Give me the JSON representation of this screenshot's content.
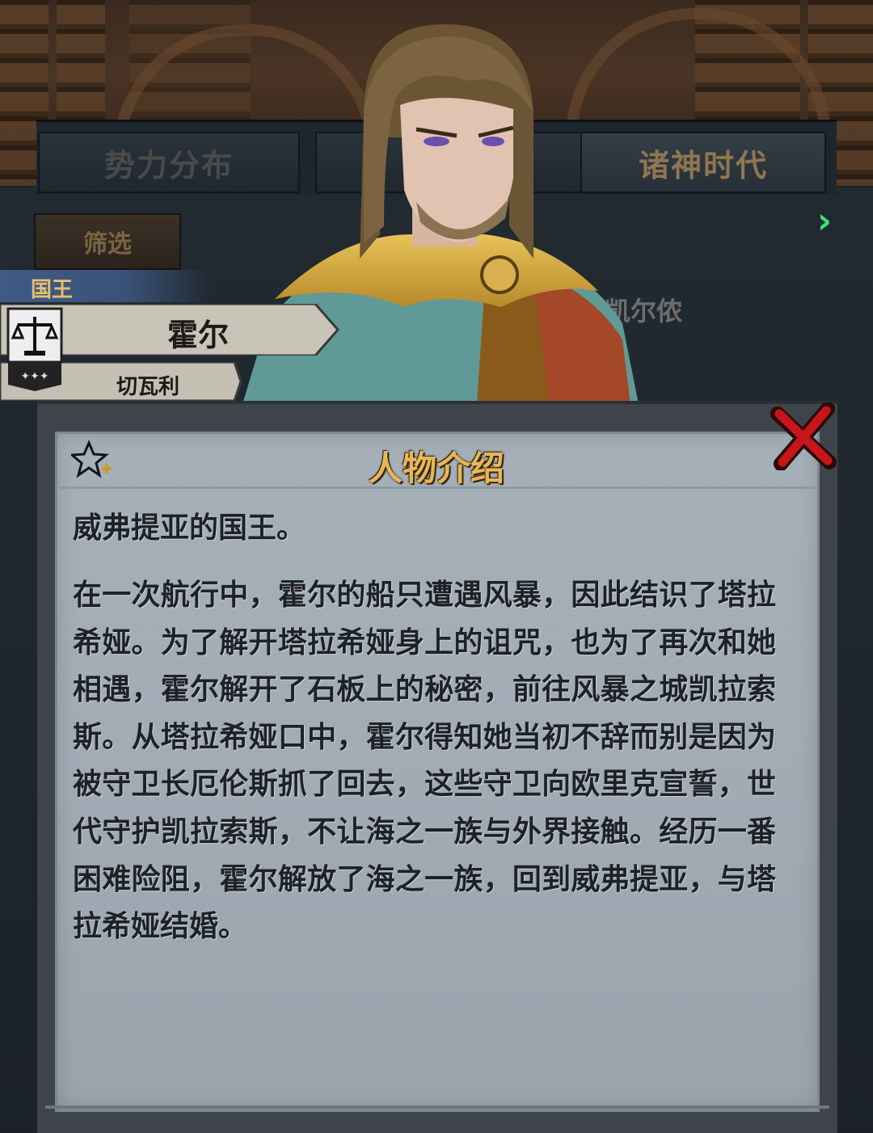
{
  "tabs": [
    {
      "label": "势力分布",
      "active": false
    },
    {
      "label": "",
      "active": false
    },
    {
      "label": "诸神时代",
      "active": true
    }
  ],
  "filter": {
    "label": "筛选"
  },
  "background_list": {
    "visible_name": "凯尔侬"
  },
  "character": {
    "title": "国王",
    "name": "霍尔",
    "faction": "切瓦利"
  },
  "intro": {
    "heading": "人物介绍",
    "lead": "威弗提亚的国王。",
    "body": "在一次航行中，霍尔的船只遭遇风暴，因此结识了塔拉希娅。为了解开塔拉希娅身上的诅咒，也为了再次和她相遇，霍尔解开了石板上的秘密，前往风暴之城凯拉索斯。从塔拉希娅口中，霍尔得知她当初不辞而别是因为被守卫长厄伦斯抓了回去，这些守卫向欧里克宣誓，世代守护凯拉索斯，不让海之一族与外界接触。经历一番困难险阻，霍尔解放了海之一族，回到威弗提亚，与塔拉希娅结婚。"
  },
  "icons": {
    "favorite": "star-plus-icon",
    "close": "close-x-icon",
    "next": "chevron-right-icon",
    "emblem": "scales-emblem-icon"
  },
  "colors": {
    "accent_gold": "#e7b65a",
    "close_red": "#c8151b",
    "next_green": "#3fe07a",
    "title_strip_blue": "#3f5a86"
  }
}
